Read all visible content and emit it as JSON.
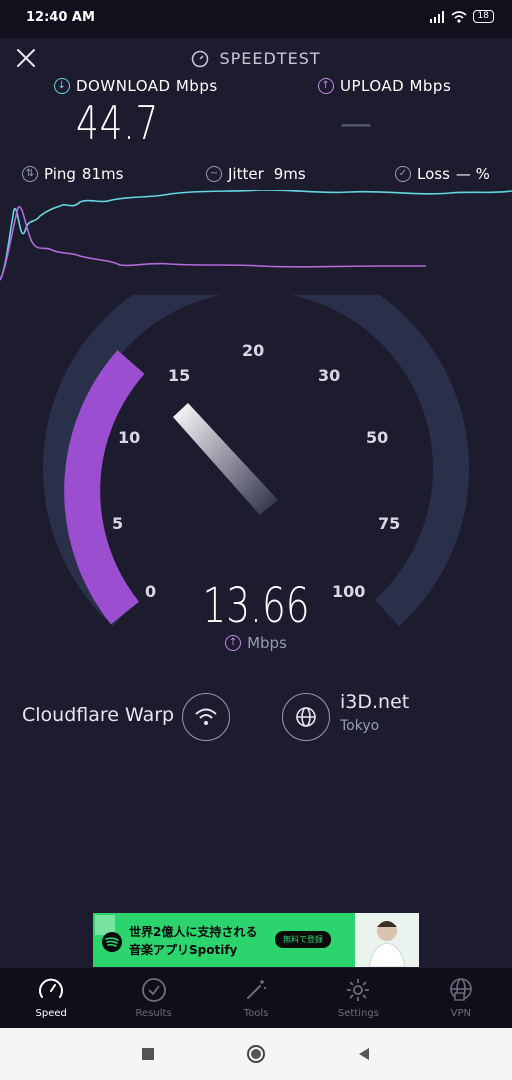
{
  "status_bar": {
    "time": "12:40 AM",
    "battery": "18"
  },
  "header": {
    "title": "SPEEDTEST"
  },
  "download": {
    "label": "DOWNLOAD Mbps",
    "value": "44.7",
    "color": "#63d6e0"
  },
  "upload": {
    "label": "UPLOAD Mbps",
    "value": "—",
    "color": "#c58be8"
  },
  "stats": {
    "ping": {
      "label": "Ping",
      "value": "81ms"
    },
    "jitter": {
      "label": "Jitter",
      "value": "9ms"
    },
    "loss": {
      "label": "Loss",
      "value": "— %"
    }
  },
  "gauge": {
    "ticks": [
      "0",
      "5",
      "10",
      "15",
      "20",
      "30",
      "50",
      "75",
      "100"
    ],
    "value": "13.66",
    "unit": "Mbps",
    "accent": "#9b4fd0"
  },
  "connection": {
    "provider": "Cloudflare Warp",
    "server_name": "i3D.net",
    "server_location": "Tokyo"
  },
  "ad": {
    "line1": "世界2億人に支持される",
    "line2": "音楽アプリSpotify",
    "cta": "無料で登録"
  },
  "nav": {
    "items": [
      {
        "label": "Speed",
        "icon": "speedometer-icon"
      },
      {
        "label": "Results",
        "icon": "check-circle-icon"
      },
      {
        "label": "Tools",
        "icon": "magic-wand-icon"
      },
      {
        "label": "Settings",
        "icon": "gear-icon"
      },
      {
        "label": "VPN",
        "icon": "globe-lock-icon"
      }
    ]
  }
}
